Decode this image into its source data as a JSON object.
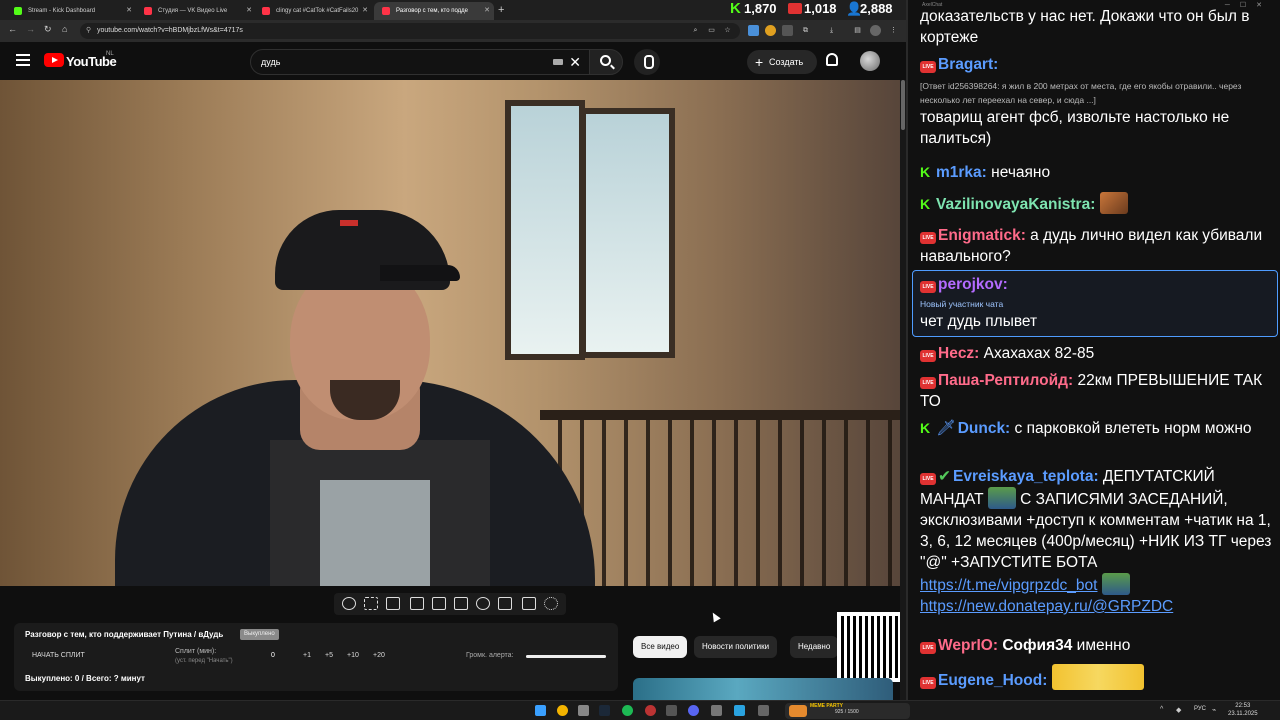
{
  "tabs": [
    {
      "title": "Stream - Kick Dashboard",
      "favicon_color": "#53fc18"
    },
    {
      "title": "Студия — VK Видео Live",
      "favicon_color": "#ff3347"
    },
    {
      "title": "clingy cat #CatTok #CatFails20",
      "favicon_color": "#ff3347"
    },
    {
      "title": "Разговор с тем, кто подде",
      "favicon_color": "#ff3347"
    }
  ],
  "stats": {
    "kick": "1,870",
    "vk": "1,018",
    "total": "2,888"
  },
  "address_bar": {
    "url": "youtube.com/watch?v=hBDMjbzLfWs&t=4717s"
  },
  "youtube": {
    "logo_text": "YouTube",
    "region": "NL",
    "search_query": "дудь",
    "create_label": "Создать"
  },
  "split_panel": {
    "title": "Разговор с тем, кто поддерживает Путина / вДудь",
    "badge": "Выкуплено",
    "start_button": "НАЧАТЬ СПЛИТ",
    "minutes_label": "Сплит (мин):",
    "minutes_sub": "(уст. перед \"Начать\")",
    "minutes_value": "0",
    "steps": [
      "+1",
      "+5",
      "+10",
      "+20"
    ],
    "alert_label": "Громк. алерта:",
    "alert_volume": 1.0,
    "footer": "Выкуплено: 0 / Всего: ? минут"
  },
  "chips": [
    "Все видео",
    "Новости политики",
    "Недавно"
  ],
  "chat": {
    "window_title": "AxelChat",
    "messages": [
      {
        "text": "доказательств у нас нет. Докажи что он был в кортеже"
      },
      {
        "platform": "live",
        "user": "Bragart:",
        "user_color": "#5b9cff",
        "quote": "[Ответ id256398264: я жил в 200 метрах от места, где его якобы отравили.. через несколько лет переехал на север, и сюда ...]",
        "text": "товарищ агент фсб, извольте настолько не палиться)"
      },
      {
        "platform": "kick",
        "user": "m1rka:",
        "user_color": "#5b9cff",
        "text": "нечаяно"
      },
      {
        "platform": "kick",
        "user": "VazilinovayaKanistra:",
        "user_color": "#7ee4b0",
        "text": ""
      },
      {
        "platform": "live",
        "user": "Enigmatick:",
        "user_color": "#ff6b8a",
        "text": "а дудь лично видел как убивали навального?"
      },
      {
        "platform": "live",
        "user": "perojkov:",
        "user_color": "#b46bff",
        "note": "Новый участник чата",
        "text": "чет дудь плывет"
      },
      {
        "platform": "live",
        "user": "Hecz:",
        "user_color": "#ff6b8a",
        "text": "Ахахахах 82-85"
      },
      {
        "platform": "live",
        "user": "Паша-Рептилойд:",
        "user_color": "#ff6b8a",
        "text": "22км ПРЕВЫШЕНИЕ ТАК ТО"
      },
      {
        "platform": "kick",
        "user": "Dunck:",
        "user_color": "#5b9cff",
        "text": "с парковкой влететь норм можно"
      },
      {
        "platform": "live",
        "user": "Evreiskaya_teplota:",
        "user_color": "#5b9cff",
        "text": "ДЕПУТАТСКИЙ МАНДАТ",
        "text2": "С ЗАПИСЯМИ ЗАСЕДАНИЙ, эксклюзивами +доступ к комментам +чатик на 1, 3, 6, 12 месяцев (400р/месяц) +НИК ИЗ ТГ через \"@\" +ЗАПУСТИТЕ БОТА",
        "link1": "https://t.me/vipgrpzdc_bot",
        "link2": "https://new.donatepay.ru/@GRPZDC"
      },
      {
        "platform": "live",
        "user": "WeprIO:",
        "user_color": "#ff6b8a",
        "text": "София34",
        "text_tail": "именно"
      },
      {
        "platform": "live",
        "user": "Eugene_Hood:",
        "user_color": "#5b9cff",
        "text": ""
      }
    ]
  },
  "taskbar": {
    "meme_label": "MEME PARTY",
    "meme_counter": "925 / 1500",
    "lang": "РУС",
    "time": "22:53",
    "date": "23.11.2025"
  },
  "colors": {
    "kick_green": "#53fc18",
    "live_red": "#e03232",
    "link_blue": "#5b9cff",
    "highlight_border": "#4f9cff"
  }
}
